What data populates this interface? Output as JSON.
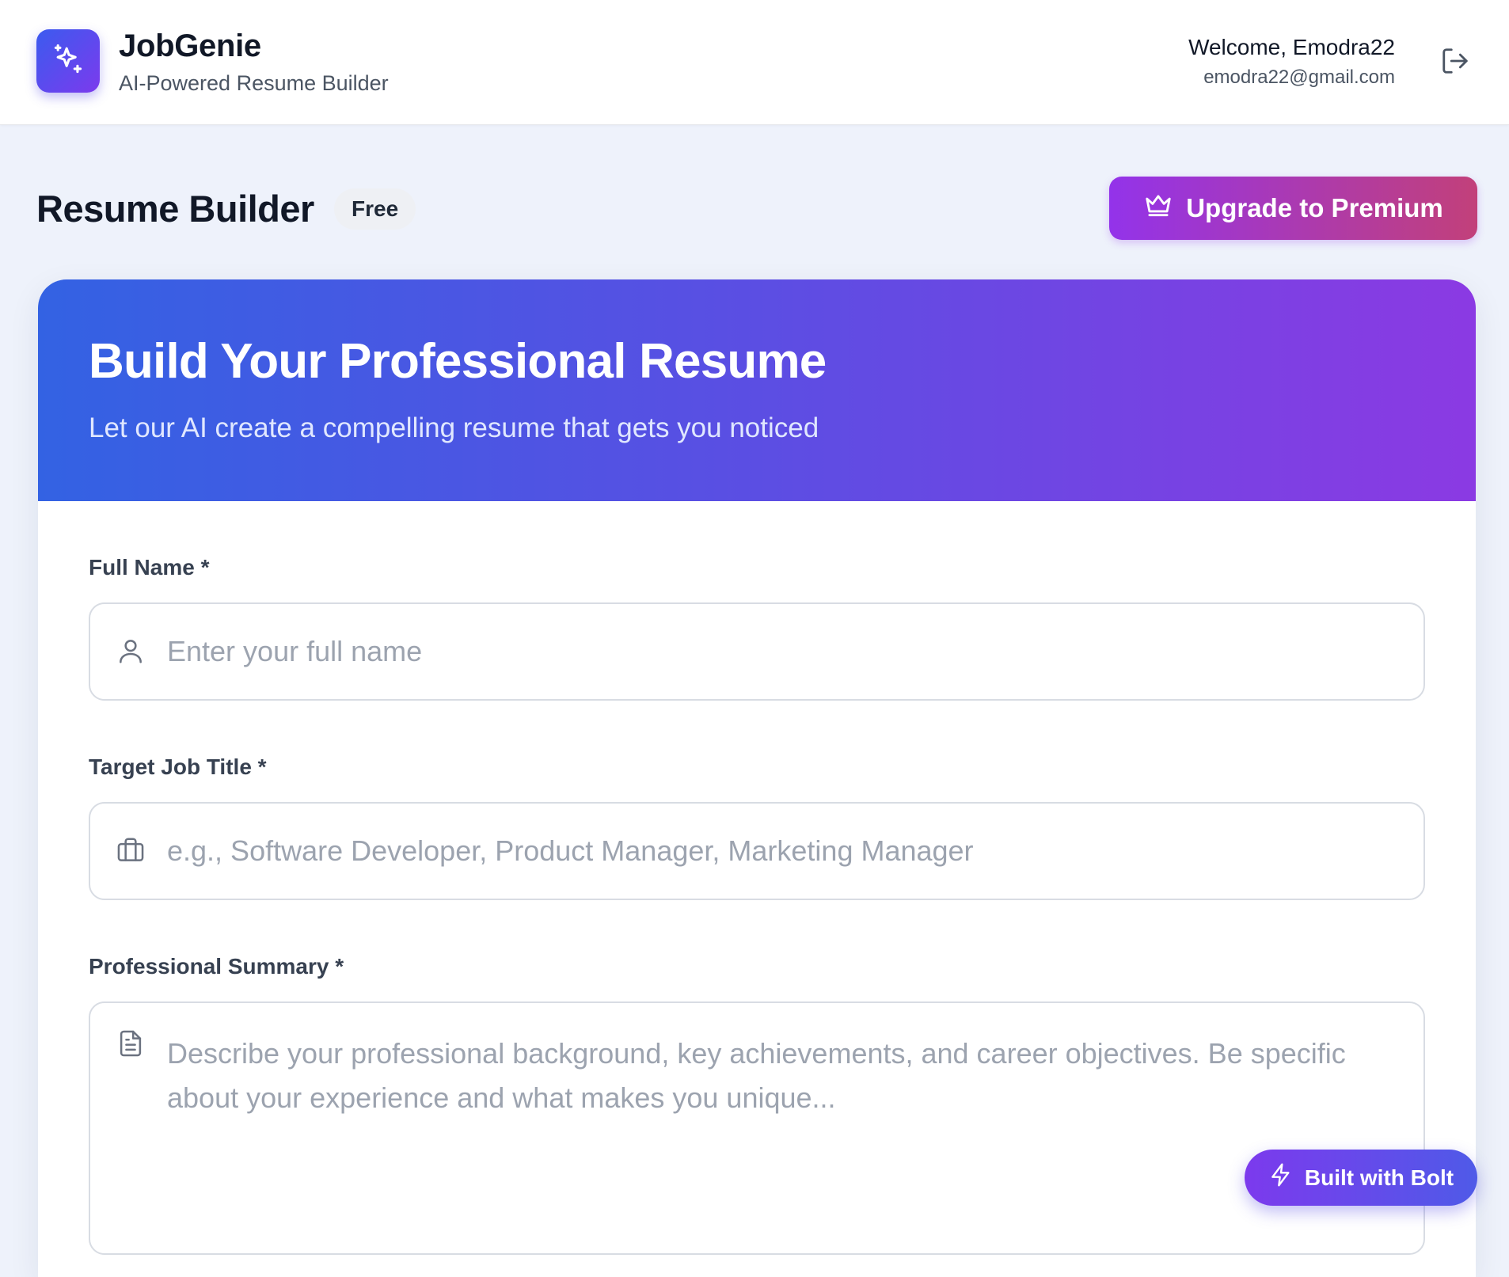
{
  "header": {
    "brand_name": "JobGenie",
    "brand_tagline": "AI-Powered Resume Builder",
    "welcome_text": "Welcome, Emodra22",
    "user_email": "emodra22@gmail.com",
    "logo_icon": "sparkles-icon",
    "logout_icon": "log-out-icon"
  },
  "page": {
    "title": "Resume Builder",
    "plan_badge": "Free",
    "upgrade_label": "Upgrade to Premium",
    "upgrade_icon": "crown-icon"
  },
  "hero": {
    "title": "Build Your Professional Resume",
    "subtitle": "Let our AI create a compelling resume that gets you noticed"
  },
  "form": {
    "full_name": {
      "label": "Full Name *",
      "placeholder": "Enter your full name",
      "value": "",
      "icon": "user-icon"
    },
    "job_title": {
      "label": "Target Job Title *",
      "placeholder": "e.g., Software Developer, Product Manager, Marketing Manager",
      "value": "",
      "icon": "briefcase-icon"
    },
    "summary": {
      "label": "Professional Summary *",
      "placeholder": "Describe your professional background, key achievements, and career objectives. Be specific about your experience and what makes you unique...",
      "value": "",
      "icon": "document-icon"
    }
  },
  "badge": {
    "label": "Built with Bolt",
    "icon": "lightning-icon"
  },
  "colors": {
    "page_background": "#eef2fb",
    "hero_gradient_start": "#3362e3",
    "hero_gradient_end": "#8b3ae3",
    "upgrade_gradient_start": "#9333ea",
    "upgrade_gradient_end": "#c2407a",
    "logo_gradient_start": "#3b5bef",
    "logo_gradient_end": "#7c3aed"
  }
}
